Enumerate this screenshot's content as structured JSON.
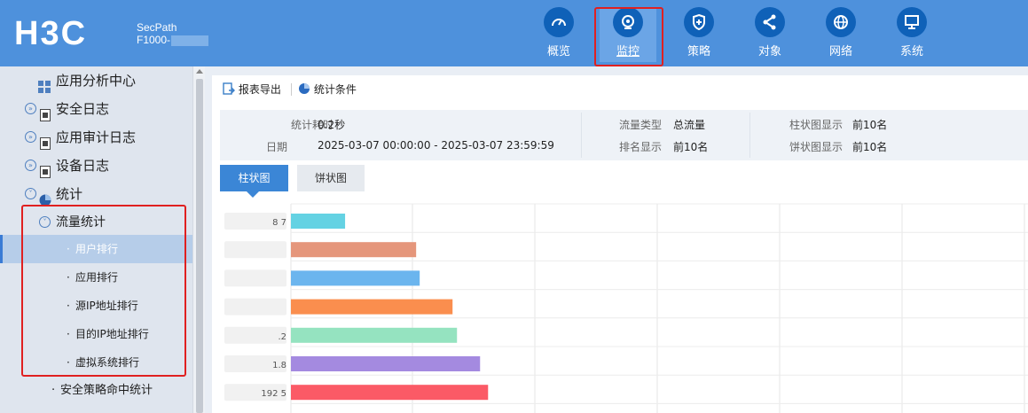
{
  "brand": {
    "logo": "H3C",
    "product_line1": "SecPath",
    "product_line2": "F1000-"
  },
  "topnav": [
    {
      "label": "概览",
      "icon": "speedometer-icon",
      "active": false
    },
    {
      "label": "监控",
      "icon": "webcam-icon",
      "active": true
    },
    {
      "label": "策略",
      "icon": "shield-plus-icon",
      "active": false
    },
    {
      "label": "对象",
      "icon": "share-nodes-icon",
      "active": false
    },
    {
      "label": "网络",
      "icon": "globe-icon",
      "active": false
    },
    {
      "label": "系统",
      "icon": "monitor-icon",
      "active": false
    }
  ],
  "sidebar": {
    "items": [
      {
        "label": "应用分析中心",
        "icon": "grid-icon"
      },
      {
        "label": "安全日志",
        "icon": "log-doc-icon"
      },
      {
        "label": "应用审计日志",
        "icon": "log-doc-icon"
      },
      {
        "label": "设备日志",
        "icon": "log-doc-icon"
      },
      {
        "label": "统计",
        "icon": "pie-icon"
      }
    ],
    "group": {
      "label": "流量统计"
    },
    "subitems": [
      {
        "label": "用户排行",
        "selected": true
      },
      {
        "label": "应用排行",
        "selected": false
      },
      {
        "label": "源IP地址排行",
        "selected": false
      },
      {
        "label": "目的IP地址排行",
        "selected": false
      },
      {
        "label": "虚拟系统排行",
        "selected": false
      }
    ],
    "extra": {
      "label": "安全策略命中统计"
    }
  },
  "toolbar": {
    "export_label": "报表导出",
    "conditions_label": "统计条件"
  },
  "info": {
    "time_cost_label": "统计耗时",
    "time_cost_value": "0.2秒",
    "date_label": "日期",
    "date_value": "2025-03-07 00:00:00 - 2025-03-07 23:59:59",
    "traffic_type_label": "流量类型",
    "traffic_type_value": "总流量",
    "rank_label": "排名显示",
    "rank_value": "前10名",
    "bar_show_label": "柱状图显示",
    "bar_show_value": "前10名",
    "pie_show_label": "饼状图显示",
    "pie_show_value": "前10名"
  },
  "tabs": {
    "bar_label": "柱状图",
    "pie_label": "饼状图"
  },
  "chart_data": {
    "type": "bar",
    "orientation": "horizontal",
    "categories": [
      "8  7",
      "",
      "",
      "",
      ".2",
      "1.8",
      "192  5"
    ],
    "values": [
      61,
      141,
      145,
      182,
      187,
      213,
      222
    ],
    "colors": [
      "#64d2e3",
      "#e5967b",
      "#6bb5ee",
      "#fa8e4e",
      "#95e3c0",
      "#a48ae0",
      "#fb5a66"
    ],
    "xlim": [
      0,
      830
    ],
    "grid": true
  }
}
